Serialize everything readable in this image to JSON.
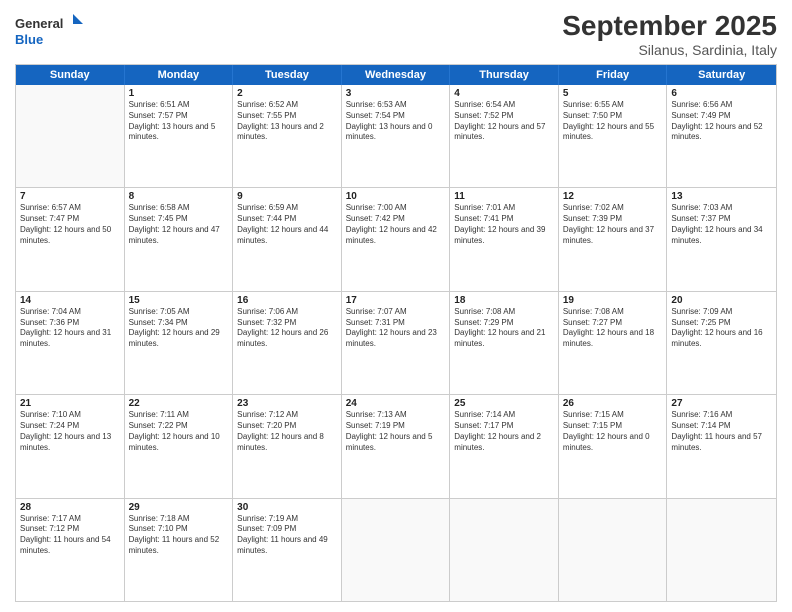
{
  "header": {
    "logo_general": "General",
    "logo_blue": "Blue",
    "month_title": "September 2025",
    "location": "Silanus, Sardinia, Italy"
  },
  "weekdays": [
    "Sunday",
    "Monday",
    "Tuesday",
    "Wednesday",
    "Thursday",
    "Friday",
    "Saturday"
  ],
  "rows": [
    [
      {
        "day": "",
        "sunrise": "",
        "sunset": "",
        "daylight": ""
      },
      {
        "day": "1",
        "sunrise": "Sunrise: 6:51 AM",
        "sunset": "Sunset: 7:57 PM",
        "daylight": "Daylight: 13 hours and 5 minutes."
      },
      {
        "day": "2",
        "sunrise": "Sunrise: 6:52 AM",
        "sunset": "Sunset: 7:55 PM",
        "daylight": "Daylight: 13 hours and 2 minutes."
      },
      {
        "day": "3",
        "sunrise": "Sunrise: 6:53 AM",
        "sunset": "Sunset: 7:54 PM",
        "daylight": "Daylight: 13 hours and 0 minutes."
      },
      {
        "day": "4",
        "sunrise": "Sunrise: 6:54 AM",
        "sunset": "Sunset: 7:52 PM",
        "daylight": "Daylight: 12 hours and 57 minutes."
      },
      {
        "day": "5",
        "sunrise": "Sunrise: 6:55 AM",
        "sunset": "Sunset: 7:50 PM",
        "daylight": "Daylight: 12 hours and 55 minutes."
      },
      {
        "day": "6",
        "sunrise": "Sunrise: 6:56 AM",
        "sunset": "Sunset: 7:49 PM",
        "daylight": "Daylight: 12 hours and 52 minutes."
      }
    ],
    [
      {
        "day": "7",
        "sunrise": "Sunrise: 6:57 AM",
        "sunset": "Sunset: 7:47 PM",
        "daylight": "Daylight: 12 hours and 50 minutes."
      },
      {
        "day": "8",
        "sunrise": "Sunrise: 6:58 AM",
        "sunset": "Sunset: 7:45 PM",
        "daylight": "Daylight: 12 hours and 47 minutes."
      },
      {
        "day": "9",
        "sunrise": "Sunrise: 6:59 AM",
        "sunset": "Sunset: 7:44 PM",
        "daylight": "Daylight: 12 hours and 44 minutes."
      },
      {
        "day": "10",
        "sunrise": "Sunrise: 7:00 AM",
        "sunset": "Sunset: 7:42 PM",
        "daylight": "Daylight: 12 hours and 42 minutes."
      },
      {
        "day": "11",
        "sunrise": "Sunrise: 7:01 AM",
        "sunset": "Sunset: 7:41 PM",
        "daylight": "Daylight: 12 hours and 39 minutes."
      },
      {
        "day": "12",
        "sunrise": "Sunrise: 7:02 AM",
        "sunset": "Sunset: 7:39 PM",
        "daylight": "Daylight: 12 hours and 37 minutes."
      },
      {
        "day": "13",
        "sunrise": "Sunrise: 7:03 AM",
        "sunset": "Sunset: 7:37 PM",
        "daylight": "Daylight: 12 hours and 34 minutes."
      }
    ],
    [
      {
        "day": "14",
        "sunrise": "Sunrise: 7:04 AM",
        "sunset": "Sunset: 7:36 PM",
        "daylight": "Daylight: 12 hours and 31 minutes."
      },
      {
        "day": "15",
        "sunrise": "Sunrise: 7:05 AM",
        "sunset": "Sunset: 7:34 PM",
        "daylight": "Daylight: 12 hours and 29 minutes."
      },
      {
        "day": "16",
        "sunrise": "Sunrise: 7:06 AM",
        "sunset": "Sunset: 7:32 PM",
        "daylight": "Daylight: 12 hours and 26 minutes."
      },
      {
        "day": "17",
        "sunrise": "Sunrise: 7:07 AM",
        "sunset": "Sunset: 7:31 PM",
        "daylight": "Daylight: 12 hours and 23 minutes."
      },
      {
        "day": "18",
        "sunrise": "Sunrise: 7:08 AM",
        "sunset": "Sunset: 7:29 PM",
        "daylight": "Daylight: 12 hours and 21 minutes."
      },
      {
        "day": "19",
        "sunrise": "Sunrise: 7:08 AM",
        "sunset": "Sunset: 7:27 PM",
        "daylight": "Daylight: 12 hours and 18 minutes."
      },
      {
        "day": "20",
        "sunrise": "Sunrise: 7:09 AM",
        "sunset": "Sunset: 7:25 PM",
        "daylight": "Daylight: 12 hours and 16 minutes."
      }
    ],
    [
      {
        "day": "21",
        "sunrise": "Sunrise: 7:10 AM",
        "sunset": "Sunset: 7:24 PM",
        "daylight": "Daylight: 12 hours and 13 minutes."
      },
      {
        "day": "22",
        "sunrise": "Sunrise: 7:11 AM",
        "sunset": "Sunset: 7:22 PM",
        "daylight": "Daylight: 12 hours and 10 minutes."
      },
      {
        "day": "23",
        "sunrise": "Sunrise: 7:12 AM",
        "sunset": "Sunset: 7:20 PM",
        "daylight": "Daylight: 12 hours and 8 minutes."
      },
      {
        "day": "24",
        "sunrise": "Sunrise: 7:13 AM",
        "sunset": "Sunset: 7:19 PM",
        "daylight": "Daylight: 12 hours and 5 minutes."
      },
      {
        "day": "25",
        "sunrise": "Sunrise: 7:14 AM",
        "sunset": "Sunset: 7:17 PM",
        "daylight": "Daylight: 12 hours and 2 minutes."
      },
      {
        "day": "26",
        "sunrise": "Sunrise: 7:15 AM",
        "sunset": "Sunset: 7:15 PM",
        "daylight": "Daylight: 12 hours and 0 minutes."
      },
      {
        "day": "27",
        "sunrise": "Sunrise: 7:16 AM",
        "sunset": "Sunset: 7:14 PM",
        "daylight": "Daylight: 11 hours and 57 minutes."
      }
    ],
    [
      {
        "day": "28",
        "sunrise": "Sunrise: 7:17 AM",
        "sunset": "Sunset: 7:12 PM",
        "daylight": "Daylight: 11 hours and 54 minutes."
      },
      {
        "day": "29",
        "sunrise": "Sunrise: 7:18 AM",
        "sunset": "Sunset: 7:10 PM",
        "daylight": "Daylight: 11 hours and 52 minutes."
      },
      {
        "day": "30",
        "sunrise": "Sunrise: 7:19 AM",
        "sunset": "Sunset: 7:09 PM",
        "daylight": "Daylight: 11 hours and 49 minutes."
      },
      {
        "day": "",
        "sunrise": "",
        "sunset": "",
        "daylight": ""
      },
      {
        "day": "",
        "sunrise": "",
        "sunset": "",
        "daylight": ""
      },
      {
        "day": "",
        "sunrise": "",
        "sunset": "",
        "daylight": ""
      },
      {
        "day": "",
        "sunrise": "",
        "sunset": "",
        "daylight": ""
      }
    ]
  ]
}
